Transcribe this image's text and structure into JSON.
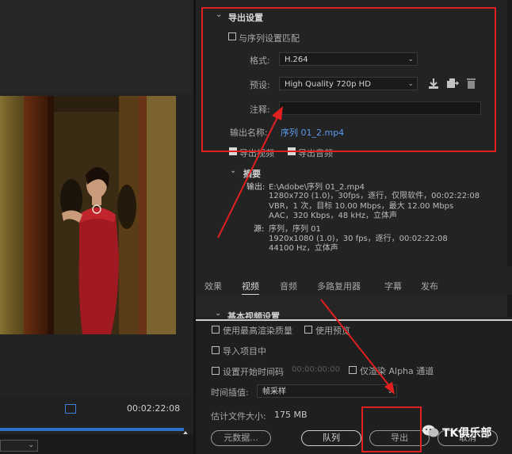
{
  "preview": {
    "timecode": "00:02:22:08"
  },
  "export_settings": {
    "section_title": "导出设置",
    "match_sequence_label": "与序列设置匹配",
    "format_label": "格式:",
    "format_value": "H.264",
    "preset_label": "预设:",
    "preset_value": "High Quality 720p HD",
    "comment_label": "注释:",
    "comment_value": "",
    "output_name_label": "输出名称:",
    "output_name_value": "序列 01_2.mp4",
    "export_video_label": "导出视频",
    "export_audio_label": "导出音频"
  },
  "summary": {
    "title": "摘要",
    "output_label": "输出:",
    "output_lines": [
      "E:\\Adobe\\序列 01_2.mp4",
      "1280x720 (1.0)，30fps，逐行，仅限软件，00:02:22:08",
      "VBR，1 次，目标 10.00 Mbps，最大 12.00 Mbps",
      "AAC，320 Kbps，48  kHz，立体声"
    ],
    "source_label": "源:",
    "source_lines": [
      "序列，序列 01",
      "1920x1080 (1.0)，30 fps，逐行，00:02:22:08",
      "44100 Hz，立体声"
    ]
  },
  "tabs": [
    "效果",
    "视频",
    "音频",
    "多路复用器",
    "字幕",
    "发布"
  ],
  "section_collapsed": "基本视频设置",
  "options": {
    "max_render_quality": "使用最高渲染质量",
    "use_preview": "使用预览",
    "import_into_project": "导入项目中",
    "set_start_timecode": "设置开始时间码",
    "start_timecode_value": "00:00:00:00",
    "render_alpha_only": "仅渲染 Alpha 通道",
    "interpolation_label": "时间插值:",
    "interpolation_value": "帧采样",
    "file_size_label": "估计文件大小:",
    "file_size_value": "175 MB"
  },
  "buttons": {
    "metadata": "元数据...",
    "queue": "队列",
    "export": "导出",
    "cancel": "取消"
  },
  "watermark": "TK俱乐部",
  "colors": {
    "highlight_red": "#e02020",
    "link_blue": "#5b9bf0",
    "progress_blue": "#2d72c8"
  }
}
